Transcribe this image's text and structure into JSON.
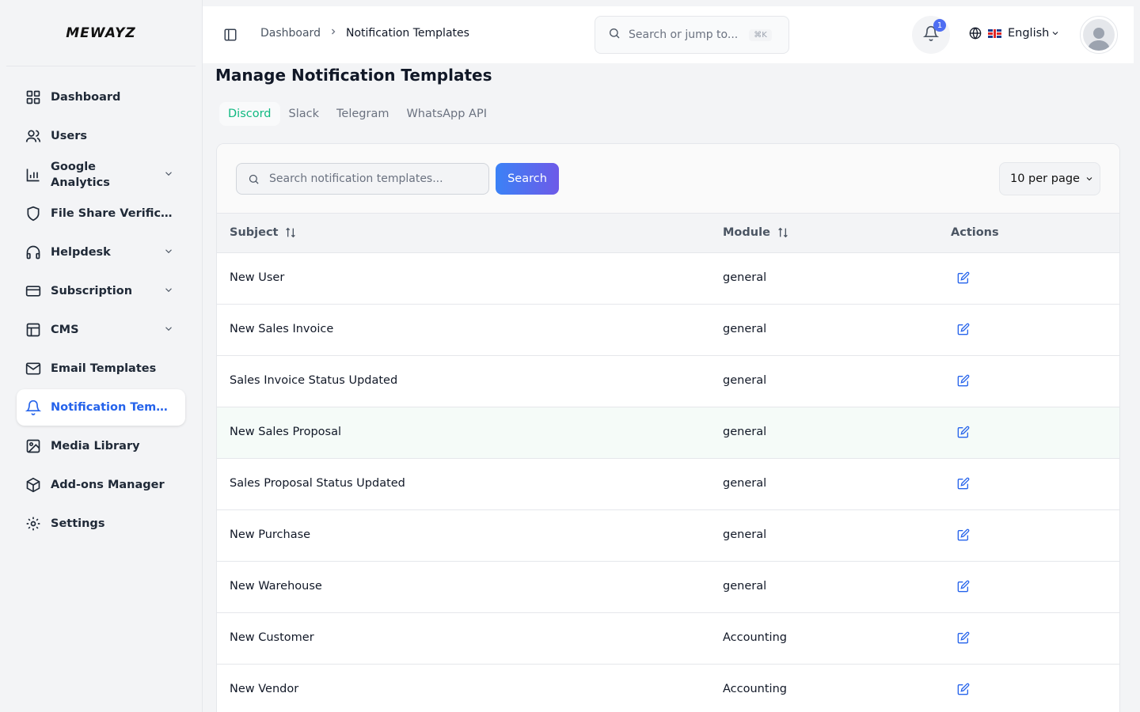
{
  "brand": "MEWAYZ",
  "sidebar": {
    "items": [
      {
        "label": "Dashboard",
        "icon": "grid-icon"
      },
      {
        "label": "Users",
        "icon": "users-icon"
      },
      {
        "label": "Google Analytics",
        "icon": "bar-chart-icon"
      },
      {
        "label": "File Share Verifica...",
        "icon": "shield-icon"
      },
      {
        "label": "Helpdesk",
        "icon": "headphones-icon"
      },
      {
        "label": "Subscription",
        "icon": "credit-card-icon"
      },
      {
        "label": "CMS",
        "icon": "layout-icon"
      },
      {
        "label": "Email Templates",
        "icon": "mail-icon"
      },
      {
        "label": "Notification Templ...",
        "icon": "bell-icon"
      },
      {
        "label": "Media Library",
        "icon": "image-icon"
      },
      {
        "label": "Add-ons Manager",
        "icon": "package-icon"
      },
      {
        "label": "Settings",
        "icon": "gear-icon"
      }
    ],
    "active_index": 8
  },
  "header": {
    "breadcrumb": [
      "Dashboard",
      "Notification Templates"
    ],
    "search_placeholder": "Search or jump to...",
    "search_shortcut": "⌘K",
    "notification_count": "1",
    "language": "English"
  },
  "page": {
    "title": "Manage Notification Templates",
    "tabs": [
      "Discord",
      "Slack",
      "Telegram",
      "WhatsApp API"
    ],
    "active_tab": 0
  },
  "table": {
    "search_placeholder": "Search notification templates...",
    "search_button": "Search",
    "per_page": "10 per page",
    "columns": [
      "Subject",
      "Module",
      "Actions"
    ],
    "rows": [
      {
        "subject": "New User",
        "module": "general"
      },
      {
        "subject": "New Sales Invoice",
        "module": "general"
      },
      {
        "subject": "Sales Invoice Status Updated",
        "module": "general"
      },
      {
        "subject": "New Sales Proposal",
        "module": "general"
      },
      {
        "subject": "Sales Proposal Status Updated",
        "module": "general"
      },
      {
        "subject": "New Purchase",
        "module": "general"
      },
      {
        "subject": "New Warehouse",
        "module": "general"
      },
      {
        "subject": "New Customer",
        "module": "Accounting"
      },
      {
        "subject": "New Vendor",
        "module": "Accounting"
      }
    ]
  },
  "colors": {
    "accent": "#2563eb",
    "tab_active": "#10b981",
    "badge": "#4f6ef2"
  }
}
